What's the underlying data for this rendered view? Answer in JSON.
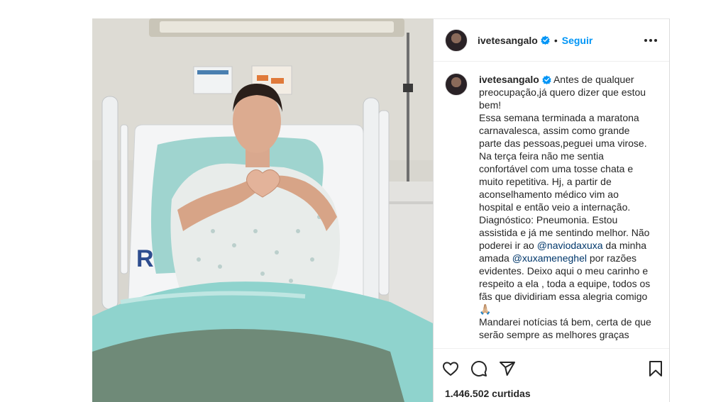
{
  "post": {
    "username": "ivetesangalo",
    "separator": "•",
    "follow_label": "Seguir",
    "caption": {
      "intro": "Antes de qualquer preocupação,já quero dizer que estou bem!\nEssa semana terminada a maratona carnavalesca, assim como grande parte das pessoas,peguei uma virose. Na terça feira não me sentia confortável com uma tosse chata e muito repetitiva. Hj, a partir de aconselhamento médico vim ao hospital e então veio a internação. Diagnóstico: Pneumonia. Estou assistida e já me sentindo melhor. Não poderei ir ao ",
      "mention1": "@naviodaxuxa",
      "mid": " da minha amada ",
      "mention2": "@xuxameneghel",
      "outro": " por razões evidentes. Deixo aqui o meu carinho e respeito a ela , toda a equipe, todos os fãs que dividiriam essa alegria comigo🙏🏼\nMandarei notícias tá bem, certa de que serão sempre as melhores graças"
    },
    "likes": "1.446.502 curtidas"
  },
  "icons": {
    "more": "more-options-icon",
    "verified": "verified-badge-icon",
    "like": "heart-icon",
    "comment": "comment-icon",
    "share": "share-icon",
    "save": "bookmark-icon"
  },
  "colors": {
    "follow": "#0095f6",
    "verified": "#0095f6",
    "mention": "#00376b",
    "text": "#262626",
    "border": "#dbdbdb"
  }
}
